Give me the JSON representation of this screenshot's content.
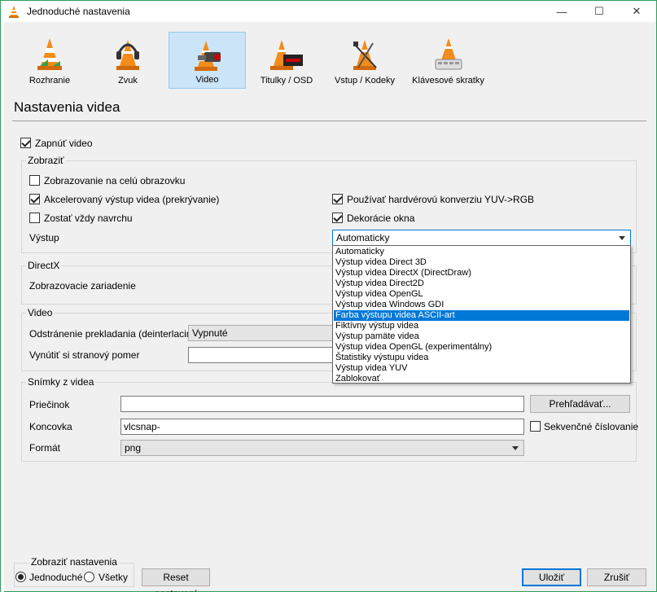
{
  "window": {
    "title": "Jednoduché nastavenia",
    "minimize_glyph": "—",
    "maximize_glyph": "☐",
    "close_glyph": "✕"
  },
  "toolbar": {
    "items": [
      {
        "label": "Rozhranie",
        "icon": "interface-cone-icon"
      },
      {
        "label": "Zvuk",
        "icon": "audio-headphones-cone-icon"
      },
      {
        "label": "Video",
        "icon": "video-cone-icon"
      },
      {
        "label": "Titulky / OSD",
        "icon": "subtitles-cone-icon"
      },
      {
        "label": "Vstup / Kodeky",
        "icon": "input-codecs-cone-icon"
      },
      {
        "label": "Klávesové skratky",
        "icon": "hotkeys-cone-icon"
      }
    ],
    "active_index": 2
  },
  "page_title": "Nastavenia videa",
  "enable_video": {
    "label": "Zapnúť video",
    "checked": true
  },
  "display": {
    "title": "Zobraziť",
    "fullscreen": {
      "label": "Zobrazovanie na celú obrazovku",
      "checked": false
    },
    "overlay": {
      "label": "Akcelerovaný výstup videa (prekrývanie)",
      "checked": true
    },
    "hw_yuv": {
      "label": "Používať hardvérovú konverziu YUV->RGB",
      "checked": true
    },
    "always_on_top": {
      "label": "Zostať vždy navrchu",
      "checked": false
    },
    "decorations": {
      "label": "Dekorácie okna",
      "checked": true
    },
    "output_label": "Výstup",
    "output_value": "Automaticky",
    "output_options": [
      "Automaticky",
      "Výstup videa Direct 3D",
      "Výstup videa DirectX (DirectDraw)",
      "Výstup videa Direct2D",
      "Výstup videa OpenGL",
      "Výstup videa Windows GDI",
      "Farba výstupu videa ASCII-art",
      "Fiktívny výstup videa",
      "Výstup pamäte videa",
      "Výstup videa OpenGL (experimentálny)",
      "Štatistiky výstupu videa",
      "Výstup videa YUV",
      "Zablokovať"
    ],
    "highlighted_option_index": 6
  },
  "directx": {
    "title": "DirectX",
    "device_label": "Zobrazovacie zariadenie"
  },
  "video": {
    "title": "Video",
    "deinterlace_label": "Odstránenie prekladania (deinterlacing)",
    "deinterlace_value": "Vypnuté",
    "aspect_label": "Vynútiť si stranový pomer",
    "aspect_value": ""
  },
  "snapshots": {
    "title": "Snímky z videa",
    "folder_label": "Priečinok",
    "folder_value": "",
    "browse_label": "Prehľadávať...",
    "prefix_label": "Koncovka",
    "prefix_value": "vlcsnap-",
    "sequential": {
      "label": "Sekvenčné číslovanie",
      "checked": false
    },
    "format_label": "Formát",
    "format_value": "png"
  },
  "footer": {
    "show_settings_title": "Zobraziť nastavenia",
    "simple_label": "Jednoduché",
    "all_label": "Všetky",
    "mode": "simple",
    "reset_label": "Reset nastavení",
    "save_label": "Uložiť",
    "cancel_label": "Zrušiť"
  },
  "colors": {
    "accent": "#0078d7",
    "active_tab_bg": "#cce4f7",
    "cone_orange": "#f28c1b"
  }
}
